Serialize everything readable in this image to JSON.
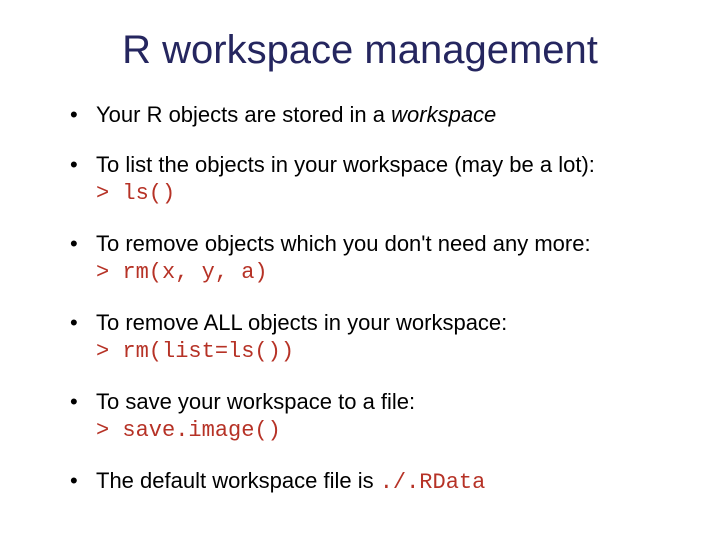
{
  "title": "R workspace management",
  "bullets": {
    "b1_pre": "Your R objects are stored in a ",
    "b1_em": "workspace",
    "b2_text": "To list the objects in your workspace (may be a lot):",
    "b2_code": "> ls()",
    "b3_text": "To remove objects which you don't need any more:",
    "b3_code": "> rm(x, y, a)",
    "b4_text": "To remove ALL objects in your workspace:",
    "b4_code": "> rm(list=ls())",
    "b5_text": "To save your workspace to a file:",
    "b5_code": "> save.image()",
    "b6_text": "The default workspace file is ",
    "b6_code": "./.RData"
  }
}
